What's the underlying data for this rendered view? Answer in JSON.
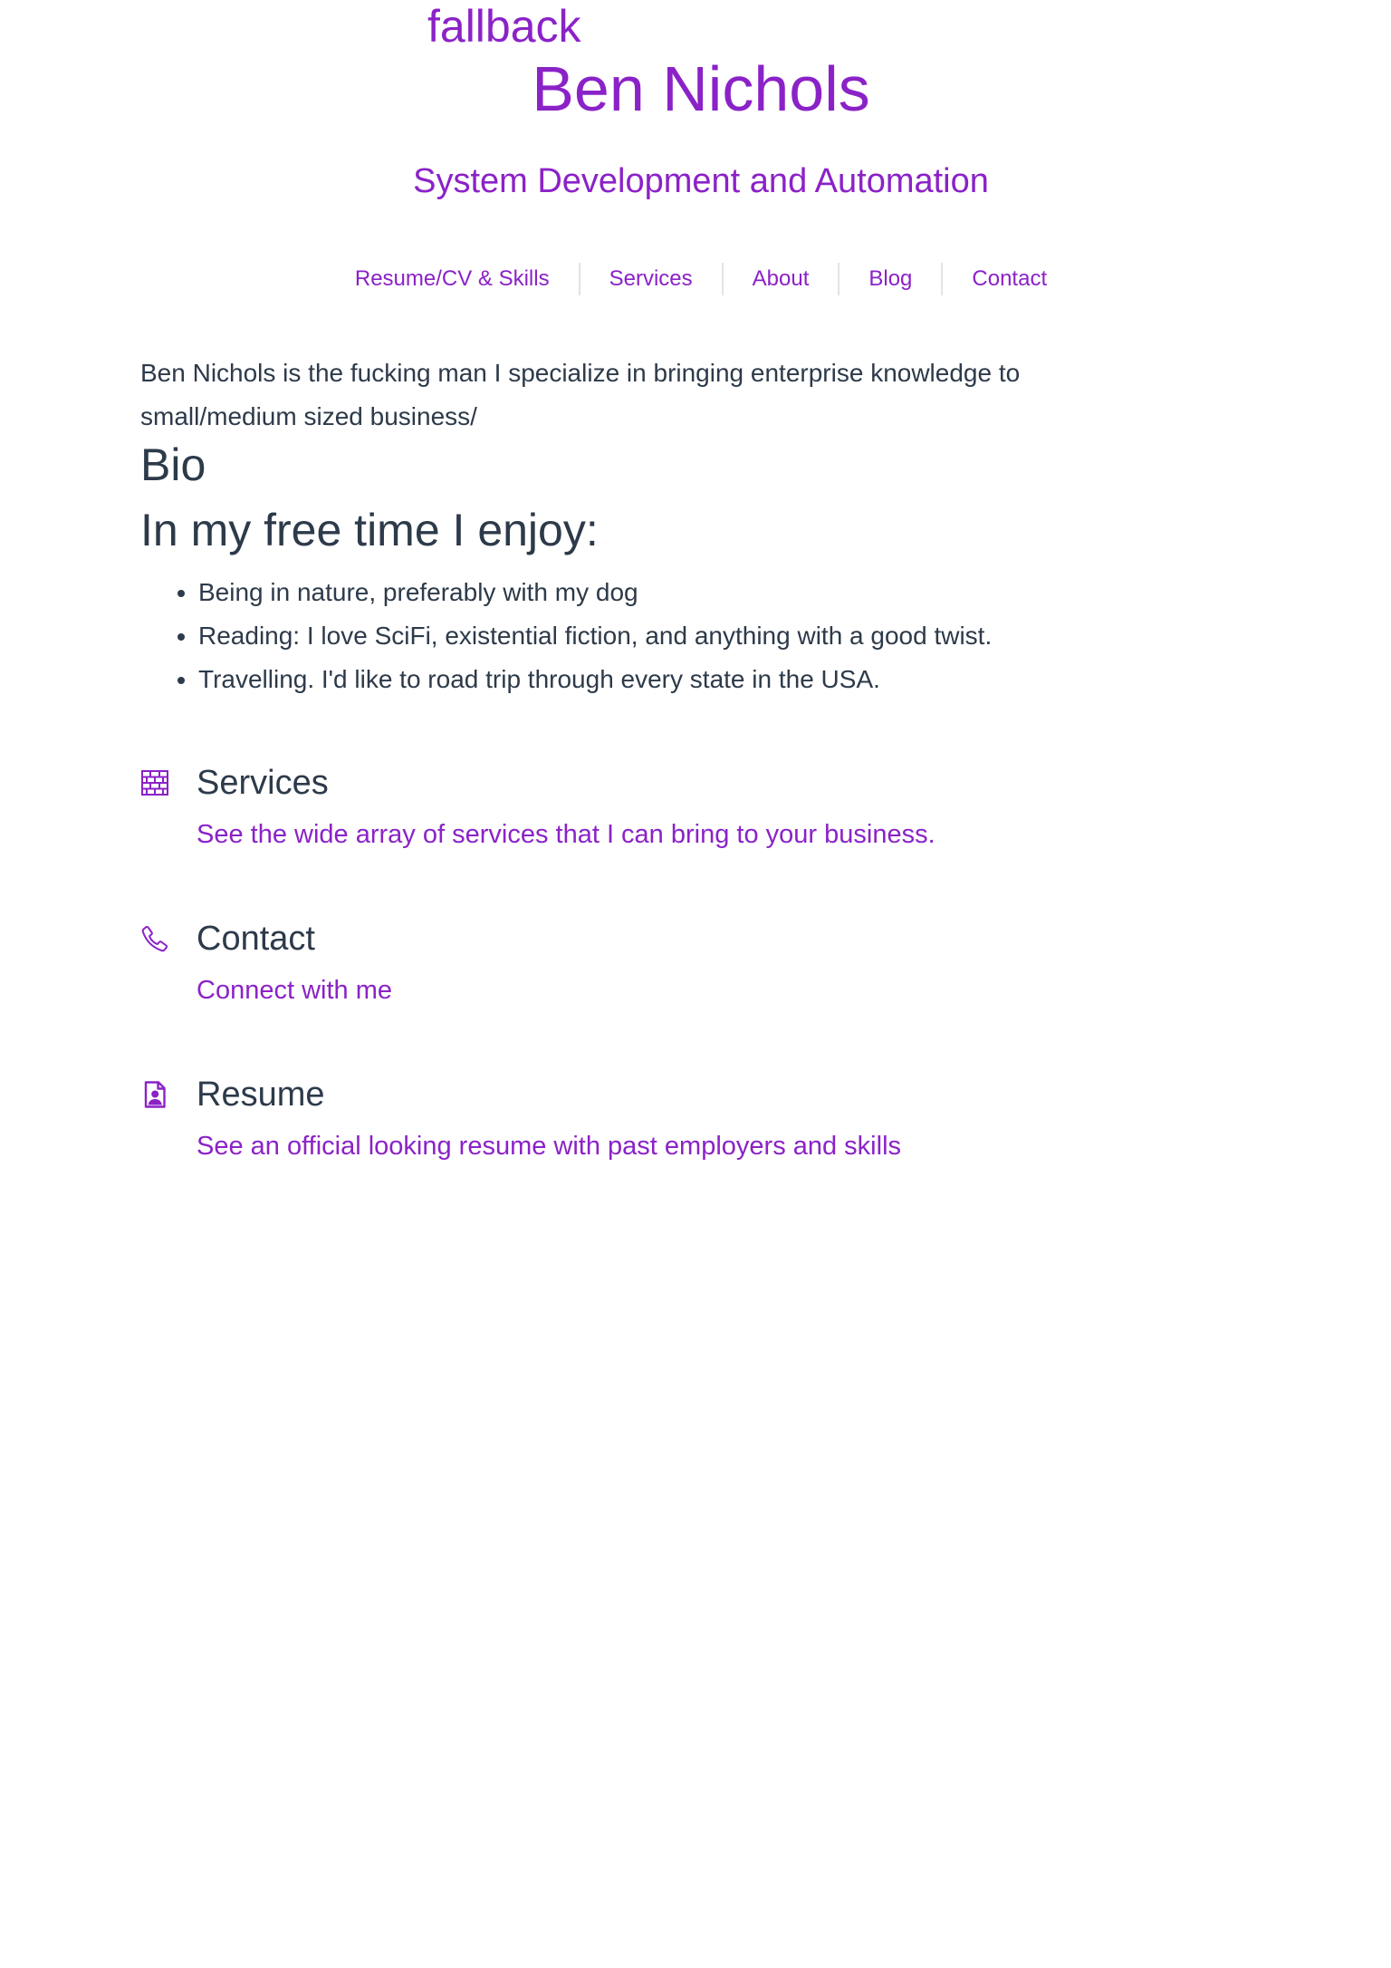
{
  "header": {
    "fallback_text": "fallback",
    "site_title": "Ben Nichols",
    "site_subtitle": "System Development and Automation"
  },
  "nav": {
    "items": [
      {
        "label": "Resume/CV & Skills"
      },
      {
        "label": "Services"
      },
      {
        "label": "About"
      },
      {
        "label": "Blog"
      },
      {
        "label": "Contact"
      }
    ]
  },
  "main": {
    "intro": "Ben Nichols is the fucking man I specialize in bringing enterprise knowledge to small/medium sized business/",
    "bio_heading": "Bio",
    "free_time_heading": "In my free time I enjoy:",
    "hobbies": [
      "Being in nature, preferably with my dog",
      "Reading: I love SciFi, existential fiction, and anything with a good twist.",
      "Travelling. I'd like to road trip through every state in the USA."
    ]
  },
  "features": [
    {
      "icon": "brick-wall-icon",
      "title": "Services",
      "link": "See the wide array of services that I can bring to your business."
    },
    {
      "icon": "phone-icon",
      "title": "Contact",
      "link": "Connect with me"
    },
    {
      "icon": "resume-document-icon",
      "title": "Resume",
      "link": "See an official looking resume with past employers and skills"
    }
  ],
  "colors": {
    "accent": "#8b22c7",
    "text": "#2d3a4a",
    "separator": "#e3e3e8",
    "background": "#ffffff"
  }
}
